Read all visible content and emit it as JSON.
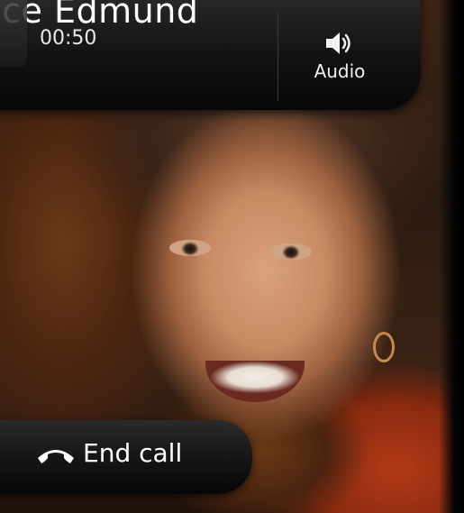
{
  "call": {
    "caller_name": "lice Edmund",
    "timer": "00:50"
  },
  "controls": {
    "audio_label": "Audio",
    "audio_icon": "speaker-icon",
    "end_call_label": "End call",
    "end_call_icon": "phone-hangup-icon"
  },
  "colors": {
    "panel": "#121212",
    "text": "#ffffff"
  }
}
